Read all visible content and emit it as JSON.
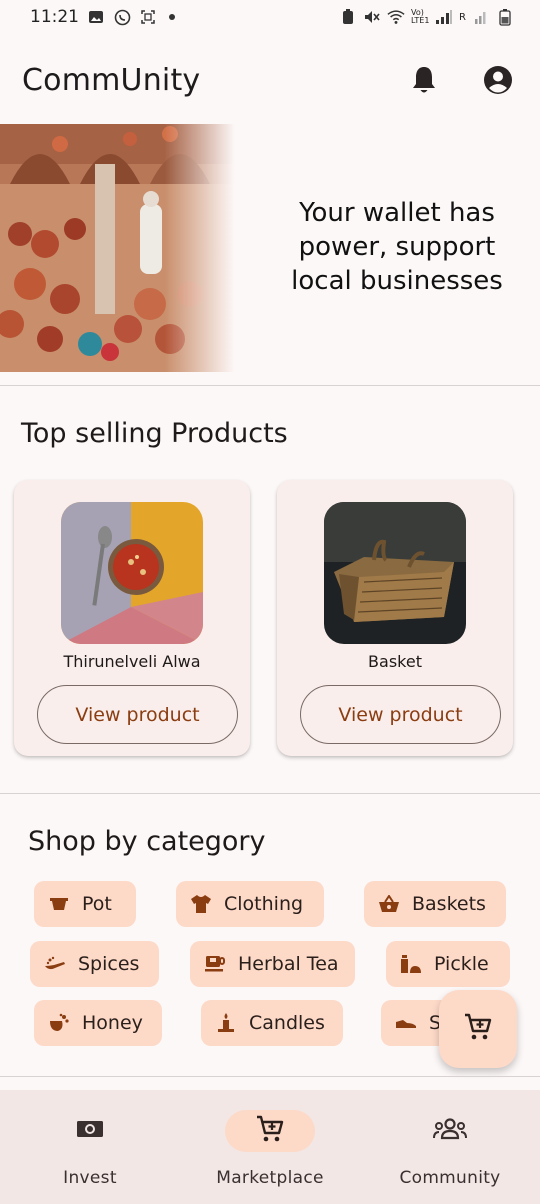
{
  "status_bar": {
    "time": "11:21",
    "left_icons": [
      "image-icon",
      "whatsapp-icon",
      "screenshot-icon",
      "dot-icon"
    ],
    "right_icons": [
      "battery-saver-icon",
      "mute-icon",
      "wifi-icon",
      "signal-icon",
      "battery-icon"
    ],
    "network_label": "Vo) LTE1",
    "roaming_label": "R"
  },
  "app_bar": {
    "title": "CommUnity",
    "actions": [
      "bell-icon",
      "account-icon"
    ]
  },
  "hero": {
    "image": "pottery-market-photo",
    "tagline": "Your wallet has power, support local businesses"
  },
  "top_selling": {
    "title": "Top selling Products",
    "products": [
      {
        "name": "Thirunelveli Alwa",
        "image": "alwa-bowl-photo",
        "button_label": "View product"
      },
      {
        "name": "Basket",
        "image": "wicker-basket-photo",
        "button_label": "View product"
      }
    ]
  },
  "categories": {
    "title": "Shop by category",
    "items": [
      {
        "label": "Pot",
        "icon": "pot-icon"
      },
      {
        "label": "Clothing",
        "icon": "shirt-icon"
      },
      {
        "label": "Baskets",
        "icon": "basket-icon"
      },
      {
        "label": "Spices",
        "icon": "spices-icon"
      },
      {
        "label": "Herbal Tea",
        "icon": "tea-cup-icon"
      },
      {
        "label": "Pickle",
        "icon": "pickle-jar-icon"
      },
      {
        "label": "Honey",
        "icon": "honey-icon"
      },
      {
        "label": "Candles",
        "icon": "candle-icon"
      },
      {
        "label": "S",
        "icon": "shoe-icon"
      }
    ]
  },
  "fab": {
    "icon": "cart-icon"
  },
  "bottom_nav": {
    "items": [
      {
        "label": "Invest",
        "icon": "money-icon",
        "active": false
      },
      {
        "label": "Marketplace",
        "icon": "cart-icon",
        "active": true
      },
      {
        "label": "Community",
        "icon": "people-icon",
        "active": false
      }
    ]
  },
  "colors": {
    "accent": "#fdd9c8",
    "accent_text": "#8b3d12",
    "card_bg": "#f9eeeb",
    "nav_bg": "#f2e7e5",
    "icon_brown": "#8b3d12"
  }
}
